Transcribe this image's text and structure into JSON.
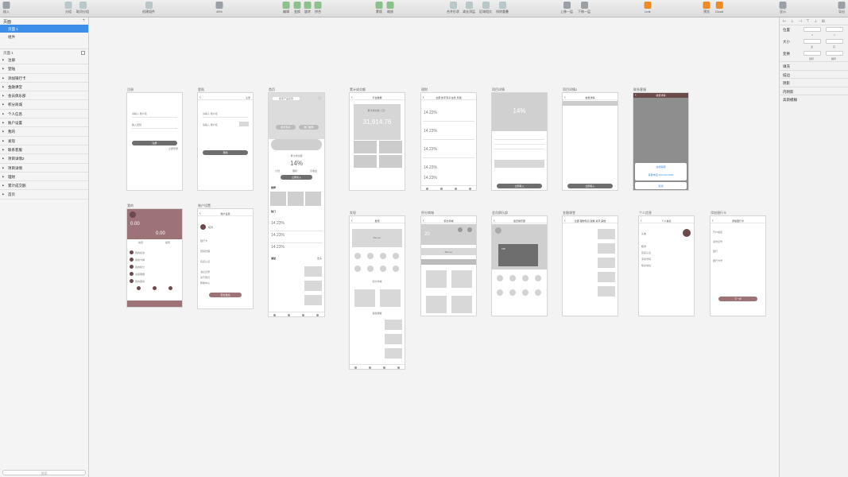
{
  "toolbar": {
    "insert": "插入",
    "group": "分组",
    "ungroup": "取消分组",
    "create_symbol": "创建组件",
    "zoom": "45%",
    "edit": "编辑",
    "transform": "变换",
    "rotate": "旋转",
    "flatten": "拼合",
    "mask": "蒙版",
    "scale": "缩放",
    "union": "合并形状",
    "subtract": "减去顶层",
    "intersect": "区域相交",
    "difference": "排除重叠",
    "forward": "上移一层",
    "backward": "下移一层",
    "link": "Link",
    "preview": "预览",
    "cloud": "Cloud",
    "view": "显示",
    "export": "导出"
  },
  "sidebar": {
    "pages_header": "页面",
    "pages": [
      "页面 1",
      "组件"
    ],
    "layers_header": "页面 1",
    "layers": [
      "注册",
      "登陆",
      "添加银行卡",
      "金融课堂",
      "会员俱乐部",
      "积分商城",
      "个人信息",
      "账户设置",
      "我的",
      "发现",
      "联系客服",
      "项目详情2",
      "项目详情",
      "理财",
      "累计成交额",
      "首页"
    ],
    "search_placeholder": "搜索"
  },
  "inspector": {
    "tools": "⊢ ⊥ ⊣ ⊤ ⊥ ⊞",
    "position": "位置",
    "size": "大小",
    "transform": "变换",
    "x": "X",
    "y": "Y",
    "width": "宽",
    "height": "高",
    "rotate": "旋转",
    "flip": "翻转",
    "fill": "填充",
    "border": "描边",
    "shadow": "阴影",
    "inner_shadow": "内阴影",
    "blur": "高斯模糊"
  },
  "artboards": {
    "register": {
      "title": "注册",
      "input1": "请输入 账户名",
      "input2": "输入密码",
      "btn": "注册",
      "link": "立即登录"
    },
    "login": {
      "title": "登陆",
      "action": "注册",
      "input1": "请输入 账户名",
      "input2": "请输入 账户名",
      "btn": "登陆"
    },
    "home": {
      "title": "首页",
      "search": "搜索产品名称",
      "b1": "新手专享",
      "b2": "热门推荐",
      "b3": "累计成交额",
      "pct": "14%",
      "c1": "计划",
      "c2": "理财",
      "c3": "高收益",
      "cta": "立即投入",
      "rec": "推荐",
      "hot": "热门",
      "class": "课堂",
      "more": "更多",
      "r1": "14.23%",
      "r2": "14.23%",
      "r3": "14.23%"
    },
    "total": {
      "title": "累计成交额",
      "nav": "平台数据",
      "num": "31,914.76",
      "lbl": "累计成交额（元）"
    },
    "finance": {
      "title": "理财",
      "tabs": "全部 新手专享 在售 售罄",
      "r1": "14.23%",
      "r2": "14.23%",
      "r3": "14.23%",
      "r4": "14.23%",
      "r5": "14.23%"
    },
    "detail": {
      "title": "项目详情",
      "pct": "14%",
      "btn": "立即投入"
    },
    "detail2": {
      "title": "项目详情2",
      "nav": "收费详情",
      "btn": "立即投入"
    },
    "service": {
      "title": "联系客服",
      "nav": "收费详情",
      "a1": "在线客服",
      "a2": "客服电话 400-000-0000",
      "cancel": "取消"
    },
    "mine": {
      "title": "我的",
      "v1": "0.00",
      "v2": "0.00",
      "t1": "充值",
      "t2": "提现",
      "m1": "我的投资",
      "m2": "我的卡券",
      "m3": "我的积分",
      "m4": "交易明细",
      "m5": "我的邀请"
    },
    "account": {
      "title": "账户设置",
      "nav": "账户设置",
      "name": "昵称",
      "r1": "银行卡",
      "r2": "密码管理",
      "r3": "实名认证",
      "r4": "消息记录",
      "r5": "关于我们",
      "r6": "帮助中心",
      "btn": "安全退出"
    },
    "discover": {
      "title": "发现",
      "nav": "发现",
      "banner": "Banner",
      "mall": "积分商城",
      "class": "金融课堂"
    },
    "points": {
      "title": "积分商城",
      "nav": "积分商城",
      "pts": "20",
      "b1": "Banner"
    },
    "club": {
      "title": "会员俱乐部",
      "nav": "会员俱乐部",
      "lvl": "VIP"
    },
    "classroom": {
      "title": "金融课堂",
      "tabs": "全部 理财知识 政策 资讯 其他"
    },
    "profile": {
      "title": "个人信息",
      "nav": "个人信息",
      "r1": "头像",
      "r2": "昵称",
      "r3": "实名认证",
      "r4": "手机号码",
      "r5": "联系地址"
    },
    "bankcard": {
      "title": "添加银行卡",
      "nav": "添加银行卡",
      "r1": "开户姓名",
      "r2": "身份证号",
      "r3": "银行",
      "r4": "银行卡号",
      "btn": "下一步"
    }
  },
  "colors": {
    "accent": "#6b4a4c",
    "rose": "#9e7377",
    "selection": "#3d8ee9"
  }
}
